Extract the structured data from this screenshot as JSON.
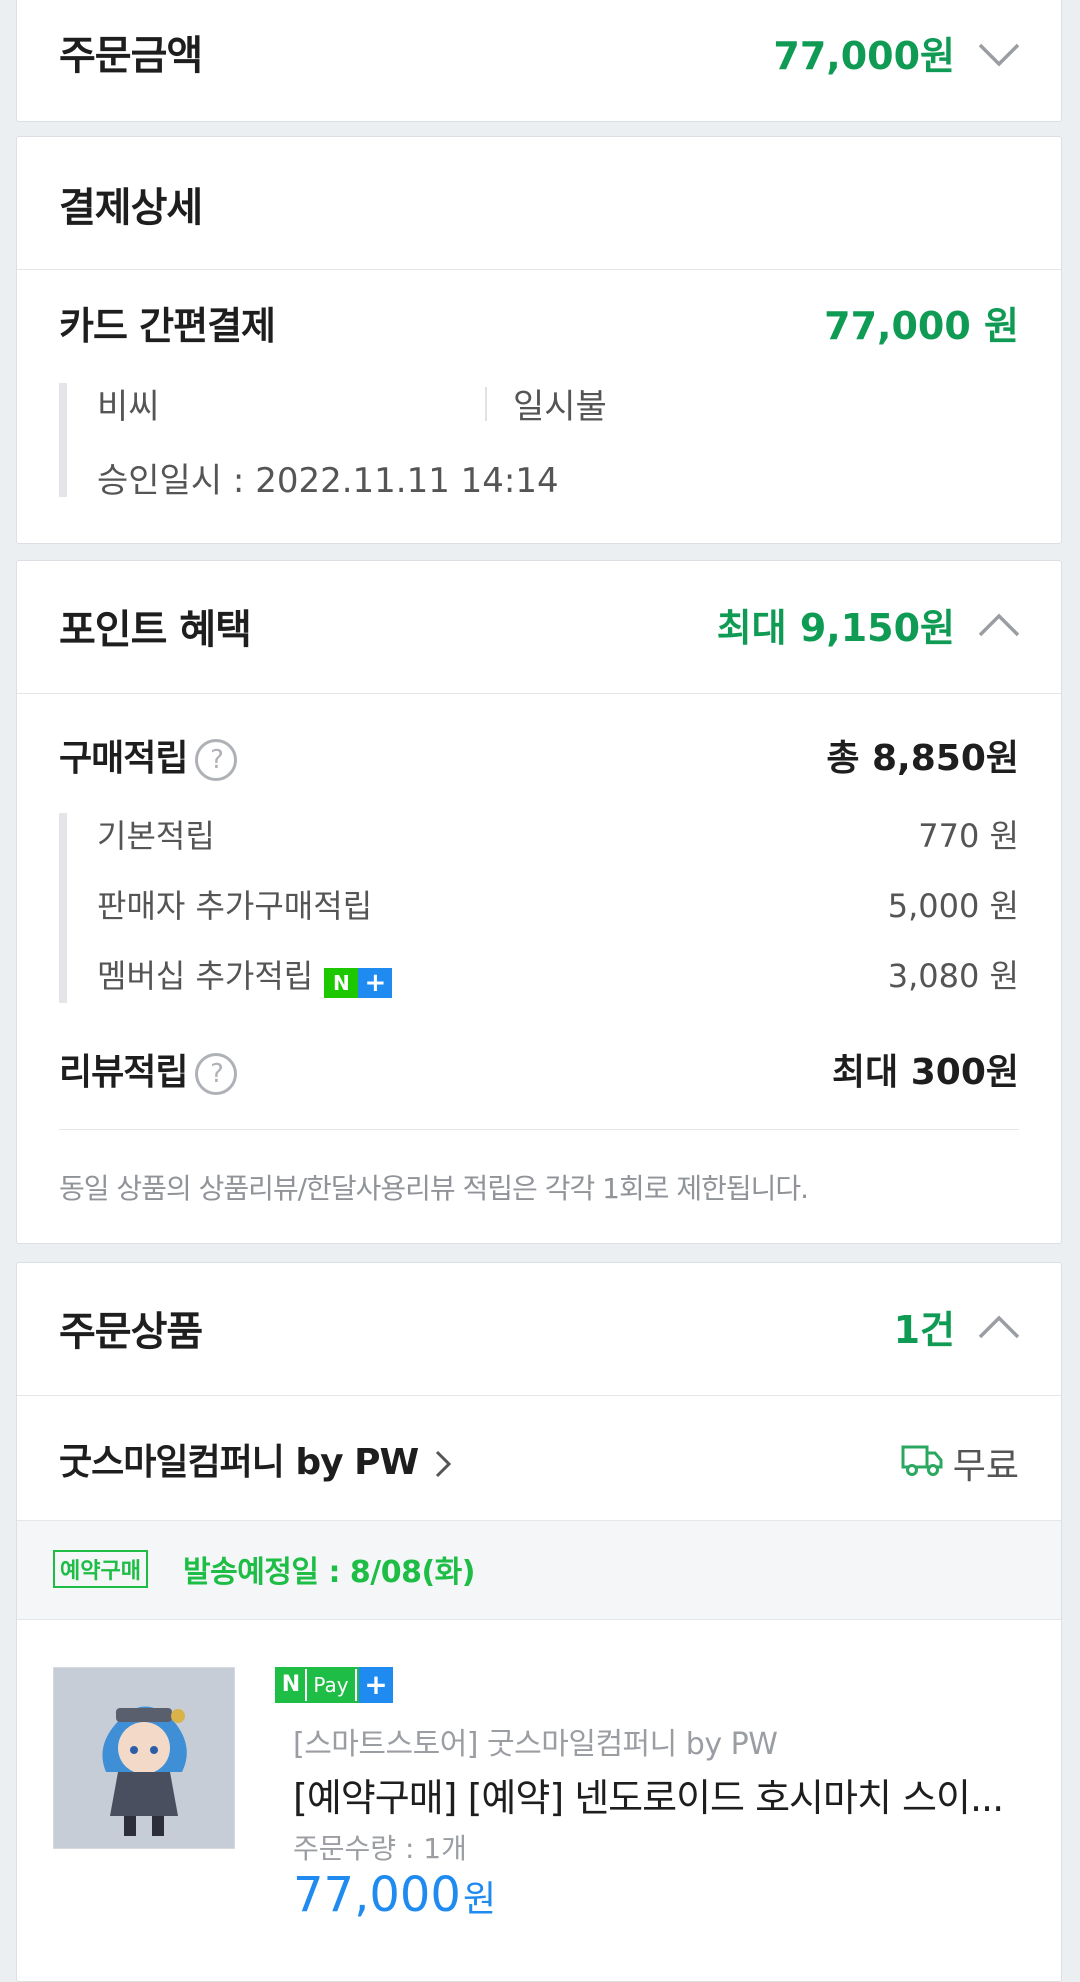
{
  "order_amount": {
    "title": "주문금액",
    "value": "77,000원"
  },
  "payment_detail": {
    "title": "결제상세",
    "method": "카드 간편결제",
    "amount": "77,000 원",
    "card_company": "비씨",
    "installment": "일시불",
    "approval": "승인일시 : 2022.11.11 14:14"
  },
  "points": {
    "title": "포인트 혜택",
    "max": "최대 9,150원",
    "purchase_label": "구매적립",
    "purchase_total": "총 8,850원",
    "items": [
      {
        "label": "기본적립",
        "value": "770 원"
      },
      {
        "label": "판매자 추가구매적립",
        "value": "5,000 원"
      },
      {
        "label": "멤버십 추가적립",
        "value": "3,080 원"
      }
    ],
    "review_label": "리뷰적립",
    "review_value": "최대 300원",
    "notice": "동일 상품의 상품리뷰/한달사용리뷰 적립은 각각 1회로 제한됩니다.",
    "help_glyph": "?",
    "badge_n": "N",
    "badge_plus": "+"
  },
  "order_items": {
    "title": "주문상품",
    "count": "1건",
    "store": "굿스마일컴퍼니 by PW",
    "shipping": "무료",
    "reserve_badge": "예약구매",
    "ship_date": "발송예정일 : 8/08(화)",
    "product": {
      "npay_n": "N",
      "npay_text": "Pay",
      "npay_plus": "+",
      "store_tag": "[스마트스토어] 굿스마일컴퍼니 by PW",
      "name": "[예약구매] [예약] 넨도로이드 호시마치 스이...",
      "qty": "주문수량 : 1개",
      "price": "77,000",
      "price_unit": "원"
    }
  }
}
